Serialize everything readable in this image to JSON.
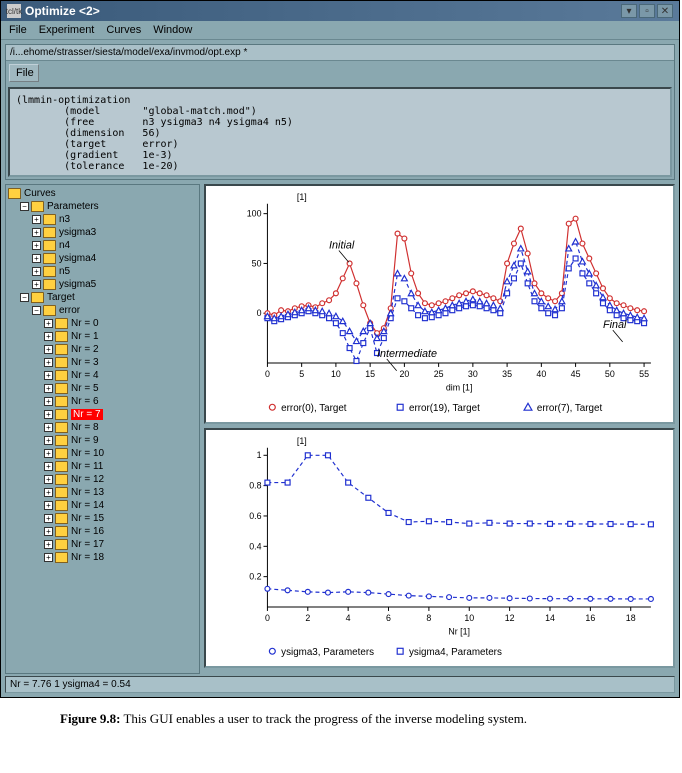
{
  "window": {
    "title": "Optimize <2>",
    "icon_label": "tcl/tk"
  },
  "menubar": [
    "File",
    "Experiment",
    "Curves",
    "Window"
  ],
  "path": "/i...ehome/strasser/siesta/model/exa/invmod/opt.exp *",
  "file_label": "File",
  "code": "(lmmin-optimization\n        (model       \"global-match.mod\")\n        (free        n3 ysigma3 n4 ysigma4 n5)\n        (dimension   56)\n        (target      error)\n        (gradient    1e-3)\n        (tolerance   1e-20)",
  "tree": {
    "root": "Curves",
    "parameters": {
      "label": "Parameters",
      "children": [
        "n3",
        "ysigma3",
        "n4",
        "ysigma4",
        "n5",
        "ysigma5"
      ]
    },
    "target": {
      "label": "Target",
      "error_label": "error",
      "nr_items": [
        "Nr = 0",
        "Nr = 1",
        "Nr = 2",
        "Nr = 3",
        "Nr = 4",
        "Nr = 5",
        "Nr = 6",
        "Nr = 7",
        "Nr = 8",
        "Nr = 9",
        "Nr = 10",
        "Nr = 11",
        "Nr = 12",
        "Nr = 13",
        "Nr = 14",
        "Nr = 15",
        "Nr = 16",
        "Nr = 17",
        "Nr = 18"
      ],
      "selected_index": 7
    }
  },
  "status": "Nr = 7.76 1   ysigma4 = 0.54",
  "caption_label": "Figure 9.8:",
  "caption_text": "This GUI enables a user to track the progress of the inverse modeling system.",
  "chart_data": [
    {
      "type": "line",
      "title": "[1]",
      "xlabel": "dim [1]",
      "ylabel": "",
      "xlim": [
        0,
        56
      ],
      "ylim": [
        -50,
        110
      ],
      "xticks": [
        0,
        5,
        10,
        15,
        20,
        25,
        30,
        35,
        40,
        45,
        50,
        55
      ],
      "yticks": [
        0,
        50,
        100
      ],
      "annotations": [
        {
          "text": "Initial",
          "x": 9,
          "y": 65
        },
        {
          "text": "Intermediate",
          "x": 16,
          "y": -44
        },
        {
          "text": "Final",
          "x": 49,
          "y": -15
        }
      ],
      "series": [
        {
          "name": "error(0), Target",
          "marker": "circle",
          "color": "#d03030",
          "x": [
            0,
            1,
            2,
            3,
            4,
            5,
            6,
            7,
            8,
            9,
            10,
            11,
            12,
            13,
            14,
            15,
            16,
            17,
            18,
            19,
            20,
            21,
            22,
            23,
            24,
            25,
            26,
            27,
            28,
            29,
            30,
            31,
            32,
            33,
            34,
            35,
            36,
            37,
            38,
            39,
            40,
            41,
            42,
            43,
            44,
            45,
            46,
            47,
            48,
            49,
            50,
            51,
            52,
            53,
            54,
            55
          ],
          "values": [
            0,
            -2,
            3,
            2,
            5,
            7,
            8,
            6,
            10,
            13,
            20,
            35,
            50,
            30,
            8,
            -10,
            -20,
            -15,
            5,
            80,
            75,
            40,
            20,
            10,
            8,
            10,
            12,
            15,
            18,
            20,
            22,
            20,
            18,
            15,
            12,
            50,
            70,
            85,
            60,
            30,
            20,
            15,
            12,
            20,
            90,
            95,
            70,
            55,
            40,
            25,
            15,
            10,
            8,
            5,
            3,
            2
          ]
        },
        {
          "name": "error(19), Target",
          "marker": "square",
          "color": "#2030d0",
          "x": [
            0,
            1,
            2,
            3,
            4,
            5,
            6,
            7,
            8,
            9,
            10,
            11,
            12,
            13,
            14,
            15,
            16,
            17,
            18,
            19,
            20,
            21,
            22,
            23,
            24,
            25,
            26,
            27,
            28,
            29,
            30,
            31,
            32,
            33,
            34,
            35,
            36,
            37,
            38,
            39,
            40,
            41,
            42,
            43,
            44,
            45,
            46,
            47,
            48,
            49,
            50,
            51,
            52,
            53,
            54,
            55
          ],
          "values": [
            -5,
            -8,
            -6,
            -4,
            -2,
            0,
            2,
            0,
            -2,
            -5,
            -10,
            -20,
            -35,
            -48,
            -30,
            -15,
            -40,
            -25,
            -5,
            15,
            12,
            5,
            -2,
            -5,
            -4,
            -2,
            0,
            3,
            5,
            7,
            8,
            7,
            5,
            3,
            0,
            20,
            35,
            50,
            30,
            12,
            5,
            0,
            -2,
            5,
            45,
            55,
            40,
            30,
            20,
            10,
            3,
            -2,
            -5,
            -7,
            -8,
            -10
          ]
        },
        {
          "name": "error(7), Target",
          "marker": "triangle",
          "color": "#2030d0",
          "x": [
            0,
            1,
            2,
            3,
            4,
            5,
            6,
            7,
            8,
            9,
            10,
            11,
            12,
            13,
            14,
            15,
            16,
            17,
            18,
            19,
            20,
            21,
            22,
            23,
            24,
            25,
            26,
            27,
            28,
            29,
            30,
            31,
            32,
            33,
            34,
            35,
            36,
            37,
            38,
            39,
            40,
            41,
            42,
            43,
            44,
            45,
            46,
            47,
            48,
            49,
            50,
            51,
            52,
            53,
            54,
            55
          ],
          "values": [
            -3,
            -5,
            -3,
            -1,
            1,
            3,
            5,
            3,
            2,
            0,
            -3,
            -8,
            -18,
            -28,
            -18,
            -10,
            -25,
            -18,
            0,
            40,
            35,
            20,
            8,
            2,
            1,
            3,
            5,
            8,
            10,
            12,
            14,
            12,
            10,
            8,
            5,
            32,
            48,
            65,
            42,
            20,
            12,
            7,
            4,
            12,
            65,
            72,
            52,
            40,
            28,
            16,
            8,
            3,
            0,
            -2,
            -4,
            -5
          ]
        }
      ]
    },
    {
      "type": "line",
      "title": "[1]",
      "xlabel": "Nr [1]",
      "ylabel": "",
      "xlim": [
        0,
        19
      ],
      "ylim": [
        0,
        1.05
      ],
      "xticks": [
        0,
        2,
        4,
        6,
        8,
        10,
        12,
        14,
        16,
        18
      ],
      "yticks": [
        0.2,
        0.4,
        0.6,
        0.8,
        1.0
      ],
      "series": [
        {
          "name": "ysigma3, Parameters",
          "marker": "circle",
          "color": "#2030d0",
          "x": [
            0,
            1,
            2,
            3,
            4,
            5,
            6,
            7,
            8,
            9,
            10,
            11,
            12,
            13,
            14,
            15,
            16,
            17,
            18,
            19
          ],
          "values": [
            0.12,
            0.11,
            0.1,
            0.095,
            0.1,
            0.095,
            0.085,
            0.075,
            0.07,
            0.065,
            0.06,
            0.06,
            0.058,
            0.056,
            0.055,
            0.055,
            0.054,
            0.054,
            0.053,
            0.053
          ]
        },
        {
          "name": "ysigma4, Parameters",
          "marker": "square",
          "color": "#2030d0",
          "x": [
            0,
            1,
            2,
            3,
            4,
            5,
            6,
            7,
            8,
            9,
            10,
            11,
            12,
            13,
            14,
            15,
            16,
            17,
            18,
            19
          ],
          "values": [
            0.82,
            0.82,
            1.0,
            1.0,
            0.82,
            0.72,
            0.62,
            0.56,
            0.565,
            0.56,
            0.55,
            0.555,
            0.55,
            0.55,
            0.548,
            0.548,
            0.547,
            0.547,
            0.546,
            0.545
          ]
        }
      ]
    }
  ]
}
